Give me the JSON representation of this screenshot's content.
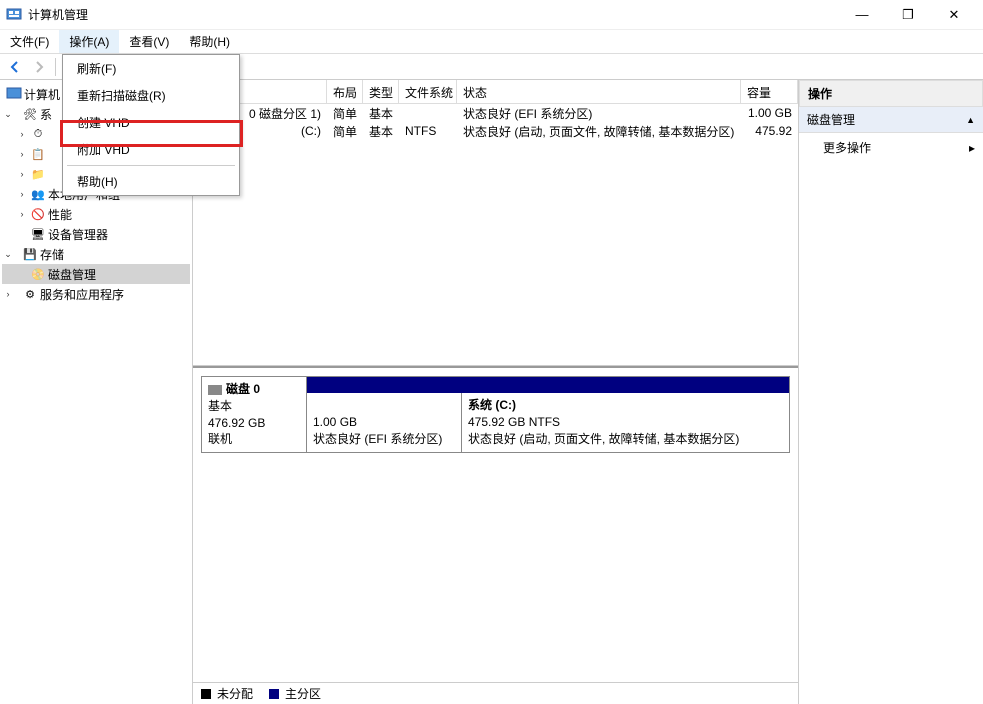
{
  "window": {
    "title": "计算机管理",
    "controls": {
      "min": "—",
      "max": "❐",
      "close": "✕"
    }
  },
  "menubar": {
    "file": "文件(F)",
    "action": "操作(A)",
    "view": "查看(V)",
    "help": "帮助(H)"
  },
  "dropdown": {
    "refresh": "刷新(F)",
    "rescan": "重新扫描磁盘(R)",
    "create_vhd": "创建 VHD",
    "attach_vhd": "附加 VHD",
    "help": "帮助(H)"
  },
  "tree": {
    "root": "计算机",
    "system_tools": "系",
    "task_scheduler": "",
    "event_viewer": "",
    "shared_folders": "",
    "local_users": "本地用户和组",
    "performance": "性能",
    "device_manager": "设备管理器",
    "storage": "存储",
    "disk_management": "磁盘管理",
    "services": "服务和应用程序"
  },
  "grid": {
    "headers": {
      "volume": "",
      "layout": "布局",
      "type": "类型",
      "fs": "文件系统",
      "status": "状态",
      "capacity": "容量"
    },
    "rows": [
      {
        "vol": "0 磁盘分区 1)",
        "layout": "简单",
        "type": "基本",
        "fs": "",
        "status": "状态良好 (EFI 系统分区)",
        "capacity": "1.00 GB"
      },
      {
        "vol": "(C:)",
        "layout": "简单",
        "type": "基本",
        "fs": "NTFS",
        "status": "状态良好 (启动, 页面文件, 故障转储, 基本数据分区)",
        "capacity": "475.92"
      }
    ]
  },
  "diagram": {
    "disk0": {
      "name": "磁盘 0",
      "type": "基本",
      "size": "476.92 GB",
      "status": "联机"
    },
    "part1": {
      "size": "1.00 GB",
      "status": "状态良好 (EFI 系统分区)"
    },
    "part2": {
      "name": "系统  (C:)",
      "size": "475.92 GB NTFS",
      "status": "状态良好 (启动, 页面文件, 故障转储, 基本数据分区)"
    }
  },
  "legend": {
    "unalloc": "未分配",
    "primary": "主分区"
  },
  "actions": {
    "header": "操作",
    "section": "磁盘管理",
    "more": "更多操作"
  }
}
